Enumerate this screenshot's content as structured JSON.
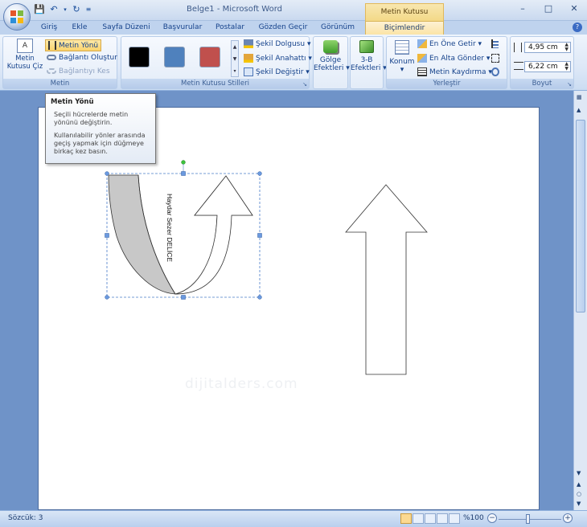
{
  "window": {
    "title": "Belge1 - Microsoft Word",
    "contextual_group": "Metin Kutusu Araçları",
    "controls": [
      "–",
      "□",
      "✕"
    ]
  },
  "tabs": [
    {
      "label": "Giriş"
    },
    {
      "label": "Ekle"
    },
    {
      "label": "Sayfa Düzeni"
    },
    {
      "label": "Başvurular"
    },
    {
      "label": "Postalar"
    },
    {
      "label": "Gözden Geçir"
    },
    {
      "label": "Görünüm"
    },
    {
      "label": "Biçimlendir"
    }
  ],
  "ribbon": {
    "metin": {
      "label": "Metin",
      "draw_textbox": "Metin Kutusu Çiz",
      "text_direction": "Metin Yönü",
      "create_link": "Bağlantı Oluştur",
      "break_link": "Bağlantıyı Kes"
    },
    "styles": {
      "label": "Metin Kutusu Stilleri",
      "swatches": [
        "#000000",
        "#4f81bd",
        "#c0504d"
      ],
      "shape_fill": "Şekil Dolgusu",
      "shape_outline": "Şekil Anahattı",
      "change_shape": "Şekil Değiştir"
    },
    "shadow": {
      "line1": "Gölge",
      "line2": "Efektleri"
    },
    "threed": {
      "line1": "3-B",
      "line2": "Efektleri"
    },
    "arrange": {
      "label": "Yerleştir",
      "position": "Konum",
      "bring_front": "En Öne Getir",
      "send_back": "En Alta Gönder",
      "text_wrap": "Metin Kaydırma"
    },
    "size": {
      "label": "Boyut",
      "height": "4,95 cm",
      "width": "6,22 cm"
    }
  },
  "tooltip": {
    "title": "Metin Yönü",
    "line1": "Seçili hücrelerde metin yönünü değiştirin.",
    "line2": "Kullanılabilir yönler arasında geçiş yapmak için düğmeye birkaç kez basın."
  },
  "document": {
    "textbox_text": "Haydar Sezer DELİCE",
    "watermark": "dijitalders.com"
  },
  "statusbar": {
    "words": "Sözcük: 3",
    "zoom": "%100"
  },
  "colors": {
    "selected_tab": "#fbe4a6",
    "curved_arrow_fill": "#c8c8c8",
    "selection_handle": "#4a7cc9",
    "rotate_handle": "#3cc33c"
  }
}
